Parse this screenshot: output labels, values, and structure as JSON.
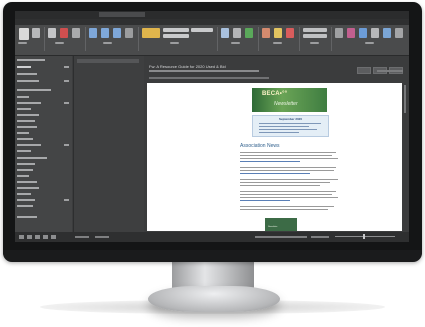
{
  "email": {
    "subject": "Fw: A Resource Guide for 2020 Used & Bid",
    "newsletter_logo": "BECA•°°",
    "newsletter_title": "Newsletter",
    "issue_date": "September 2020",
    "section_heading": "Association News"
  },
  "colors": {
    "screen_background": "#3b3c3d",
    "banner_green": "#3f7d41",
    "heading_blue": "#2f5f8c"
  }
}
